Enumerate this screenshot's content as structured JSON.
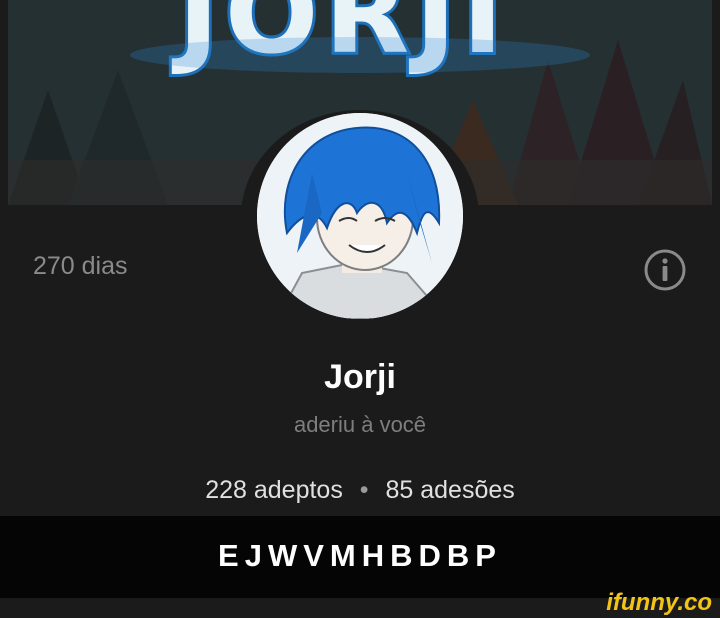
{
  "profile": {
    "banner_title": "JORJI",
    "name": "Jorji",
    "subtitle": "aderiu à você",
    "days": "270 dias",
    "followers": "228 adeptos",
    "separator": "•",
    "following": "85 adesões"
  },
  "caption": {
    "text": "EJWVMHBDBP"
  },
  "watermark": {
    "text": "ifunny.co"
  },
  "icons": {
    "info": "info-icon",
    "avatar": "anime-character-avatar"
  },
  "colors": {
    "background": "#1b1b1b",
    "caption_bar": "#050505",
    "muted_text": "#8a8a8a",
    "watermark": "#f3c418",
    "avatar_hair": "#1e74d6"
  }
}
